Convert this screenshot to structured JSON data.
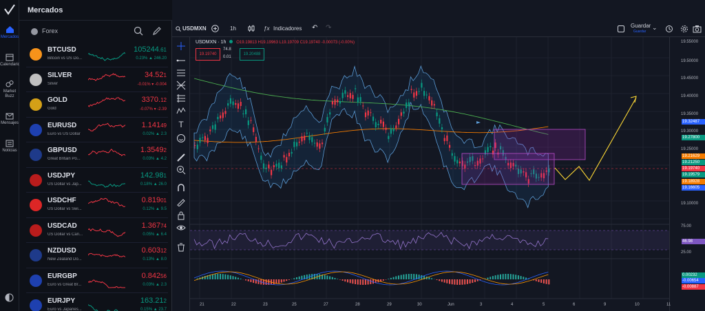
{
  "app": {
    "title": "Mercados"
  },
  "nav": {
    "items": [
      {
        "label": "Mercados",
        "icon": "home-icon"
      },
      {
        "label": "Calendario",
        "icon": "calendar-icon"
      },
      {
        "label": "Market Buzz",
        "icon": "buzz-icon"
      },
      {
        "label": "Mensajes",
        "icon": "mail-icon"
      },
      {
        "label": "Noticias",
        "icon": "news-icon"
      }
    ]
  },
  "watchlist": {
    "category": "Forex",
    "items": [
      {
        "symbol": "BTCUSD",
        "desc": "Bitcoin vs US Do...",
        "price_main": "105244",
        "price_small": ".61",
        "change": "0.23% ▲ 246.20",
        "dir": "up",
        "icon_color": "#f7931a"
      },
      {
        "symbol": "SILVER",
        "desc": "Silver",
        "price_main": "34.52",
        "price_small": "1",
        "change": "-0.01% ▾ -0.004",
        "dir": "down",
        "icon_color": "#c0c0c0"
      },
      {
        "symbol": "GOLD",
        "desc": "Gold",
        "price_main": "3370.",
        "price_small": "12",
        "change": "-0.07% ▾ -2.39",
        "dir": "down",
        "icon_color": "#d4a017"
      },
      {
        "symbol": "EURUSD",
        "desc": "Euro vs US Dollar",
        "price_main": "1.141",
        "price_small": "49",
        "change": "0.02% ▲ 2.3",
        "dir": "down",
        "icon_color": "#1e40af"
      },
      {
        "symbol": "GBPUSD",
        "desc": "Great Britain Po...",
        "price_main": "1.3549",
        "price_small": "2",
        "change": "0.03% ▲ 4.2",
        "dir": "down",
        "icon_color": "#1e3a8a"
      },
      {
        "symbol": "USDJPY",
        "desc": "US Dollar vs Jap...",
        "price_main": "142.98",
        "price_small": "1",
        "change": "0.18% ▲ 26.0",
        "dir": "up",
        "icon_color": "#b91c1c"
      },
      {
        "symbol": "USDCHF",
        "desc": "US Dollar vs Swi...",
        "price_main": "0.819",
        "price_small": "01",
        "change": "0.12% ▲ 9.5",
        "dir": "down",
        "icon_color": "#dc2626"
      },
      {
        "symbol": "USDCAD",
        "desc": "US Dollar vs Can...",
        "price_main": "1.367",
        "price_small": "74",
        "change": "0.05% ▲ 6.4",
        "dir": "down",
        "icon_color": "#b91c1c"
      },
      {
        "symbol": "NZDUSD",
        "desc": "New Zealand Do...",
        "price_main": "0.603",
        "price_small": "12",
        "change": "0.13% ▲ 8.0",
        "dir": "down",
        "icon_color": "#1e3a8a"
      },
      {
        "symbol": "EURGBP",
        "desc": "Euro vs Great Br...",
        "price_main": "0.842",
        "price_small": "56",
        "change": "0.03% ▲ 2.3",
        "dir": "down",
        "icon_color": "#1e40af"
      },
      {
        "symbol": "EURJPY",
        "desc": "Euro vs Japanes...",
        "price_main": "163.21",
        "price_small": "2",
        "change": "0.15% ▲ 23.7",
        "dir": "up",
        "icon_color": "#1e40af"
      }
    ]
  },
  "toolbar": {
    "symbol": "USDMXN",
    "interval": "1h",
    "indicators": "Indicadores",
    "save": "Guardar",
    "save_sub": "Guardar"
  },
  "legend": {
    "title": "USDMXN · 1h",
    "ohlc": "O19.19813 H19.19963 L19.19709 C19.19740 -0.00073 (-0.00%)",
    "bid": "19.19740",
    "spread_top": "74.8",
    "spread_bot": "0.01",
    "ask": "19.20488"
  },
  "price_axis": {
    "ticks": [
      "19.55000",
      "19.50000",
      "19.45000",
      "19.40000",
      "19.35000",
      "19.30000",
      "19.25000",
      "19.10000",
      "75.00",
      "25.00"
    ],
    "labels": [
      {
        "text": "19.32487",
        "color": "#2962ff"
      },
      {
        "text": "19.27800",
        "color": "#089981"
      },
      {
        "text": "19.21629",
        "color": "#f57c00"
      },
      {
        "text": "19.21250",
        "color": "#089981"
      },
      {
        "text": "19.19740",
        "color": "#f23645"
      },
      {
        "text": "19.19579",
        "color": "#089981"
      },
      {
        "text": "19.18928",
        "color": "#f57c00"
      },
      {
        "text": "19.16605",
        "color": "#2962ff"
      },
      {
        "text": "46.98",
        "color": "#7e57c2"
      },
      {
        "text": "0.00232",
        "color": "#089981"
      },
      {
        "text": "-0.00654",
        "color": "#2962ff"
      },
      {
        "text": "-0.00887",
        "color": "#f23645"
      }
    ]
  },
  "time_axis": [
    "21",
    "22",
    "23",
    "25",
    "27",
    "28",
    "29",
    "30",
    "Jun",
    "3",
    "4",
    "5",
    "6",
    "9",
    "10",
    "11"
  ],
  "colors": {
    "up": "#089981",
    "down": "#f23645",
    "accent": "#2962ff"
  }
}
